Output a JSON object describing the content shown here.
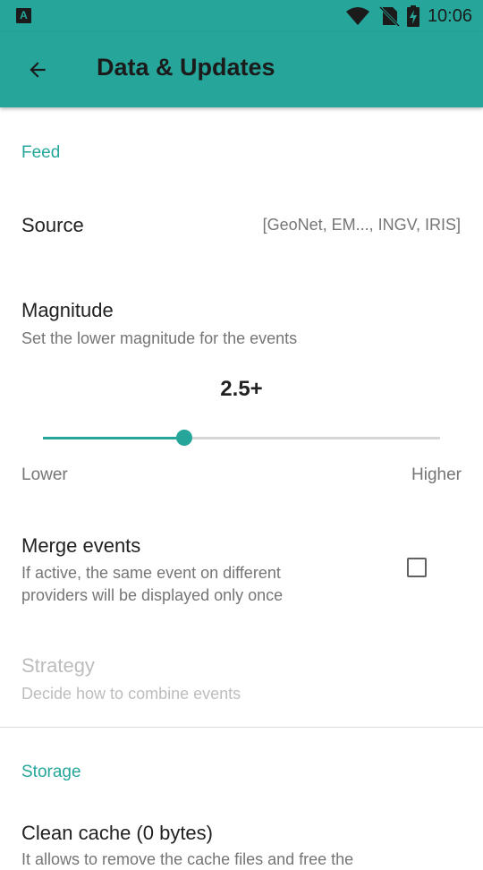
{
  "status_bar": {
    "time": "10:06",
    "icons": [
      "app-notification-icon",
      "wifi-icon",
      "no-sim-icon",
      "battery-charging-icon"
    ]
  },
  "app_bar": {
    "title": "Data & Updates",
    "back_icon": "arrow-back-icon"
  },
  "sections": {
    "feed": {
      "header": "Feed",
      "source": {
        "title": "Source",
        "value": "[GeoNet, EM..., INGV, IRIS]"
      },
      "magnitude": {
        "title": "Magnitude",
        "summary": "Set the lower magnitude for the events",
        "value_label": "2.5+",
        "slider_fraction": 0.355,
        "lower_label": "Lower",
        "higher_label": "Higher"
      },
      "merge_events": {
        "title": "Merge events",
        "summary_line1": "If active, the same event on different",
        "summary_line2": "providers will be displayed only once",
        "checked": false
      },
      "strategy": {
        "title": "Strategy",
        "summary": "Decide how to combine events",
        "enabled": false
      }
    },
    "storage": {
      "header": "Storage",
      "clean_cache": {
        "title": "Clean cache (0 bytes)",
        "summary": "It allows to remove the cache files and free the"
      }
    }
  },
  "colors": {
    "accent": "#26a69a",
    "text_primary": "#212121",
    "text_secondary": "#757575",
    "text_disabled": "#bdbdbd"
  }
}
